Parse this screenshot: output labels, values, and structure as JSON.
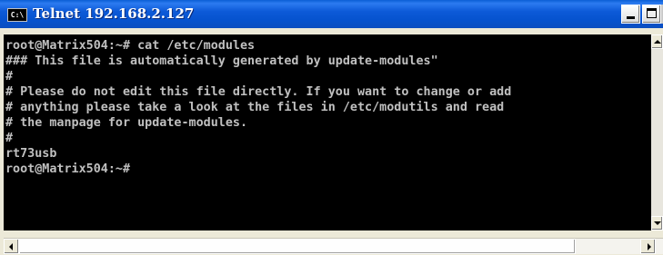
{
  "window": {
    "title": "Telnet 192.168.2.127",
    "icon_label": "C:\\",
    "icon_name": "console-icon"
  },
  "terminal": {
    "lines": [
      "root@Matrix504:~# cat /etc/modules",
      "### This file is automatically generated by update-modules\"",
      "#",
      "# Please do not edit this file directly. If you want to change or add",
      "# anything please take a look at the files in /etc/modutils and read",
      "# the manpage for update-modules.",
      "#",
      "rt73usb",
      "root@Matrix504:~#"
    ],
    "foreground_color": "#c0c0c0",
    "background_color": "#000000"
  },
  "colors": {
    "titlebar": "#0a5fd6",
    "frame": "#ece9d8"
  }
}
